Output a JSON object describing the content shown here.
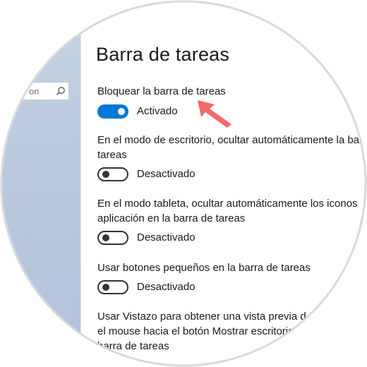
{
  "window": {
    "title": "Barra de tareas"
  },
  "search": {
    "text": "on"
  },
  "settings": [
    {
      "label": "Bloquear la barra de tareas",
      "state": "Activado",
      "on": true
    },
    {
      "label": "En el modo de escritorio, ocultar automáticamente la barra de tareas",
      "label_line1": "En el modo de escritorio, ocultar automáticamente la ba",
      "label_line2": "tareas",
      "state": "Desactivado",
      "on": false
    },
    {
      "label_line1": "En el modo tableta, ocultar automáticamente los iconos",
      "label_line2": "aplicación en la barra de tareas",
      "state": "Desactivado",
      "on": false
    },
    {
      "label": "Usar botones pequeños en la barra de tareas",
      "state": "Desactivado",
      "on": false
    },
    {
      "label_line1": "Usar Vistazo para obtener una vista previa d",
      "label_line2": "el mouse hacia el botón Mostrar escritorio",
      "label_line3": "barra de tareas"
    }
  ],
  "colors": {
    "accent": "#0078d7",
    "arrow": "#f26b6b"
  }
}
